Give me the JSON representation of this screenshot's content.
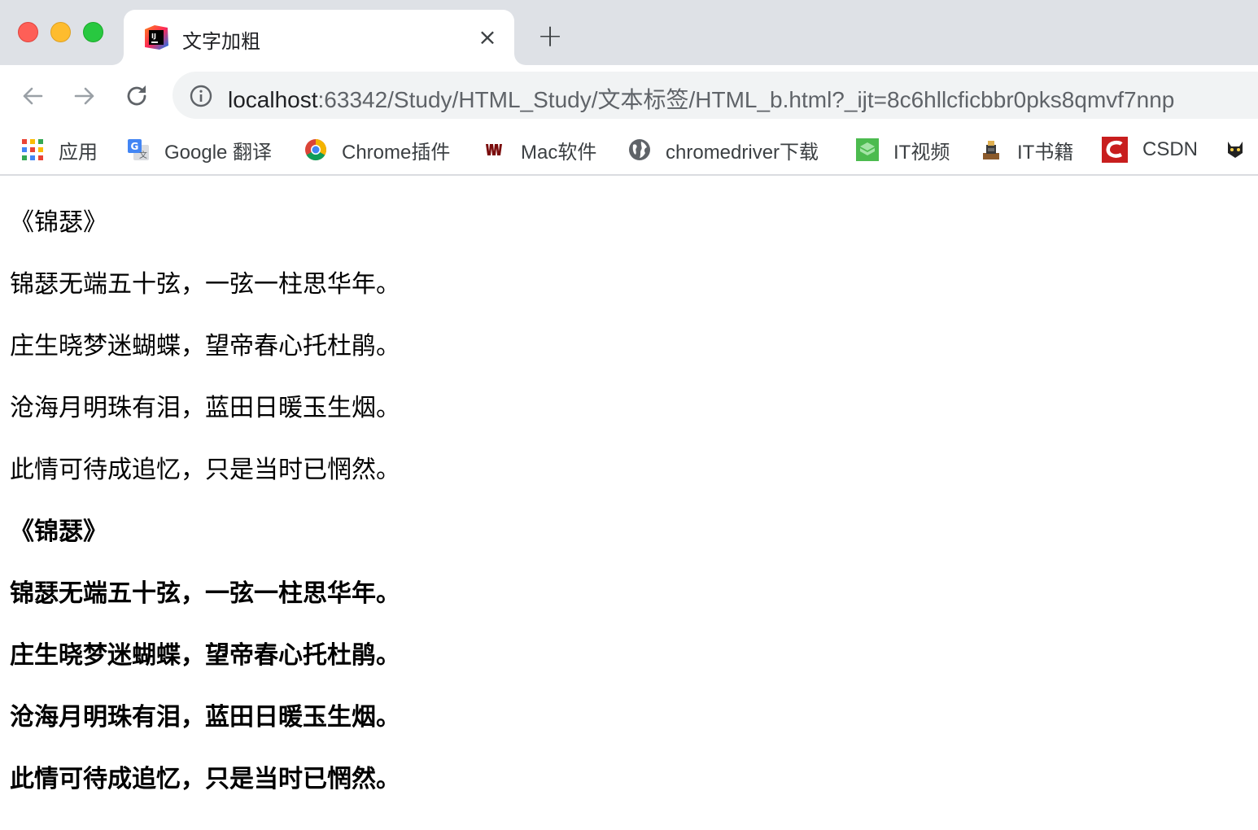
{
  "window": {
    "traffic_lights": [
      "close",
      "minimize",
      "zoom"
    ]
  },
  "tab": {
    "title": "文字加粗",
    "favicon": "intellij-idea-icon",
    "close_icon": "×",
    "new_tab_icon": "+"
  },
  "toolbar": {
    "back": "back-arrow-icon",
    "forward": "forward-arrow-icon",
    "reload": "reload-icon",
    "url_host": "localhost",
    "url_rest": ":63342/Study/HTML_Study/文本标签/HTML_b.html?_ijt=8c6hllcficbbr0pks8qmvf7nnp"
  },
  "bookmarks": [
    {
      "label": "应用",
      "icon": "apps-grid-icon"
    },
    {
      "label": "Google 翻译",
      "icon": "google-translate-icon"
    },
    {
      "label": "Chrome插件",
      "icon": "chrome-icon"
    },
    {
      "label": "Mac软件",
      "icon": "mac-software-icon"
    },
    {
      "label": "chromedriver下载",
      "icon": "globe-icon"
    },
    {
      "label": "IT视频",
      "icon": "it-video-icon"
    },
    {
      "label": "IT书籍",
      "icon": "it-books-icon"
    },
    {
      "label": "CSDN",
      "icon": "csdn-icon"
    }
  ],
  "poem": {
    "normal": [
      "《锦瑟》",
      "锦瑟无端五十弦，一弦一柱思华年。",
      "庄生晓梦迷蝴蝶，望帝春心托杜鹃。",
      "沧海月明珠有泪，蓝田日暖玉生烟。",
      "此情可待成追忆，只是当时已惘然。"
    ],
    "bold": [
      "《锦瑟》",
      "锦瑟无端五十弦，一弦一柱思华年。",
      "庄生晓梦迷蝴蝶，望帝春心托杜鹃。",
      "沧海月明珠有泪，蓝田日暖玉生烟。",
      "此情可待成追忆，只是当时已惘然。"
    ]
  },
  "colors": {
    "tabstrip_bg": "#dee1e6",
    "omnibox_bg": "#f1f3f4",
    "text": "#000000"
  }
}
